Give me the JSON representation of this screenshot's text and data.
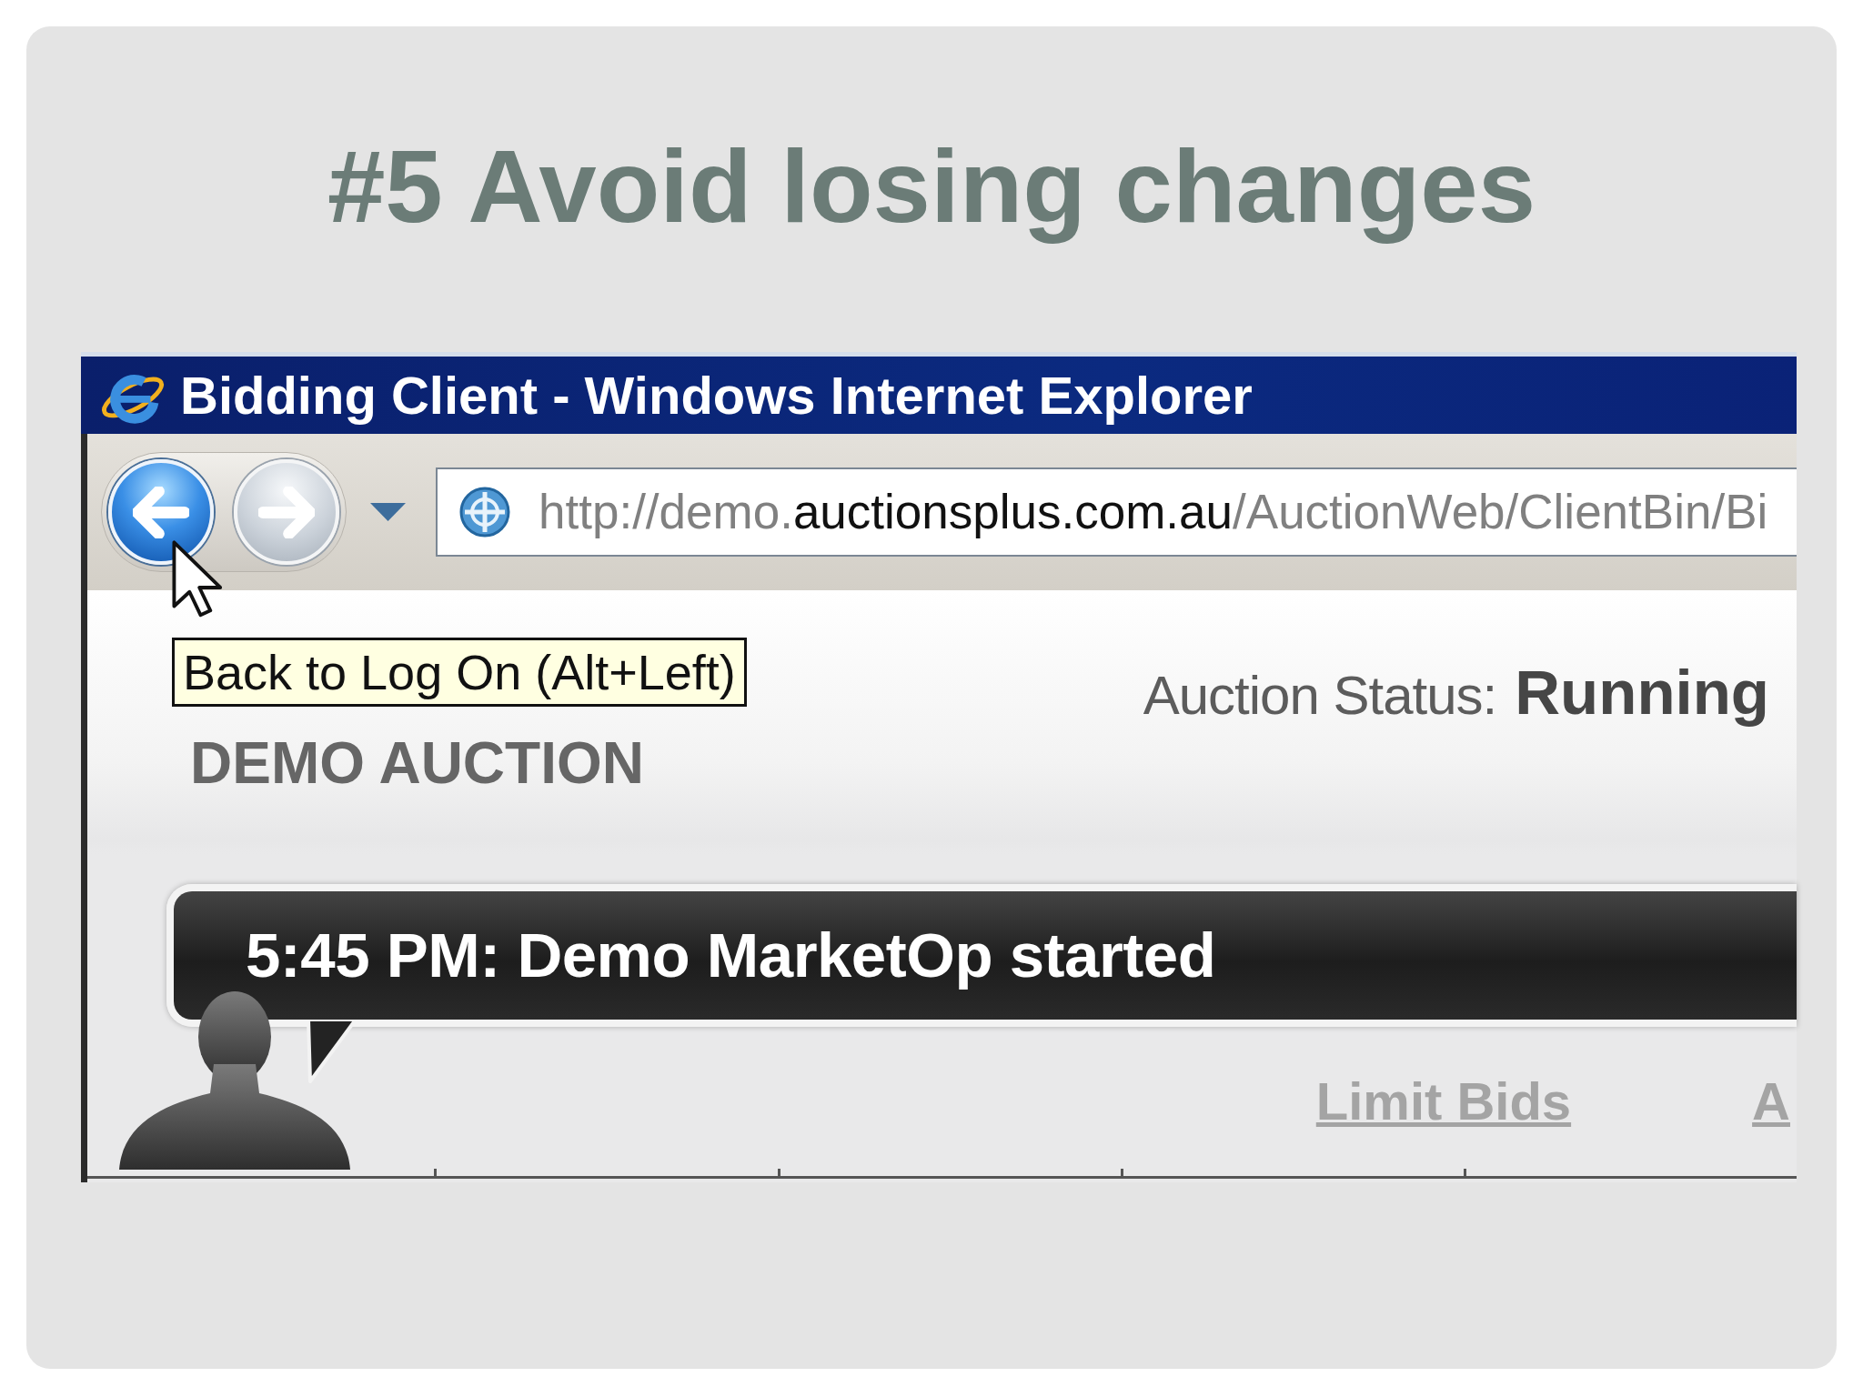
{
  "slide": {
    "title": "#5 Avoid losing changes"
  },
  "browser": {
    "title_bar": {
      "title": "Bidding Client - Windows Internet Explorer"
    },
    "toolbar": {
      "nav_buttons": [
        {
          "kind": "back",
          "disabled": false
        },
        {
          "kind": "forward",
          "disabled": true
        }
      ],
      "address_bar": {
        "segments": [
          {
            "text": "http://demo.",
            "highlighted": false
          },
          {
            "text": "auctionsplus.com.au",
            "highlighted": true
          },
          {
            "text": "/AuctionWeb/ClientBin/Bi",
            "highlighted": false
          }
        ]
      }
    },
    "tooltip": {
      "text": "Back to Log On (Alt+Left)"
    },
    "page": {
      "auction_status": {
        "label": "Auction Status:",
        "value": "Running"
      },
      "auction_name": "DEMO AUCTION",
      "message": "5:45 PM: Demo MarketOp started",
      "links": [
        "Limit Bids",
        "A"
      ]
    }
  }
}
